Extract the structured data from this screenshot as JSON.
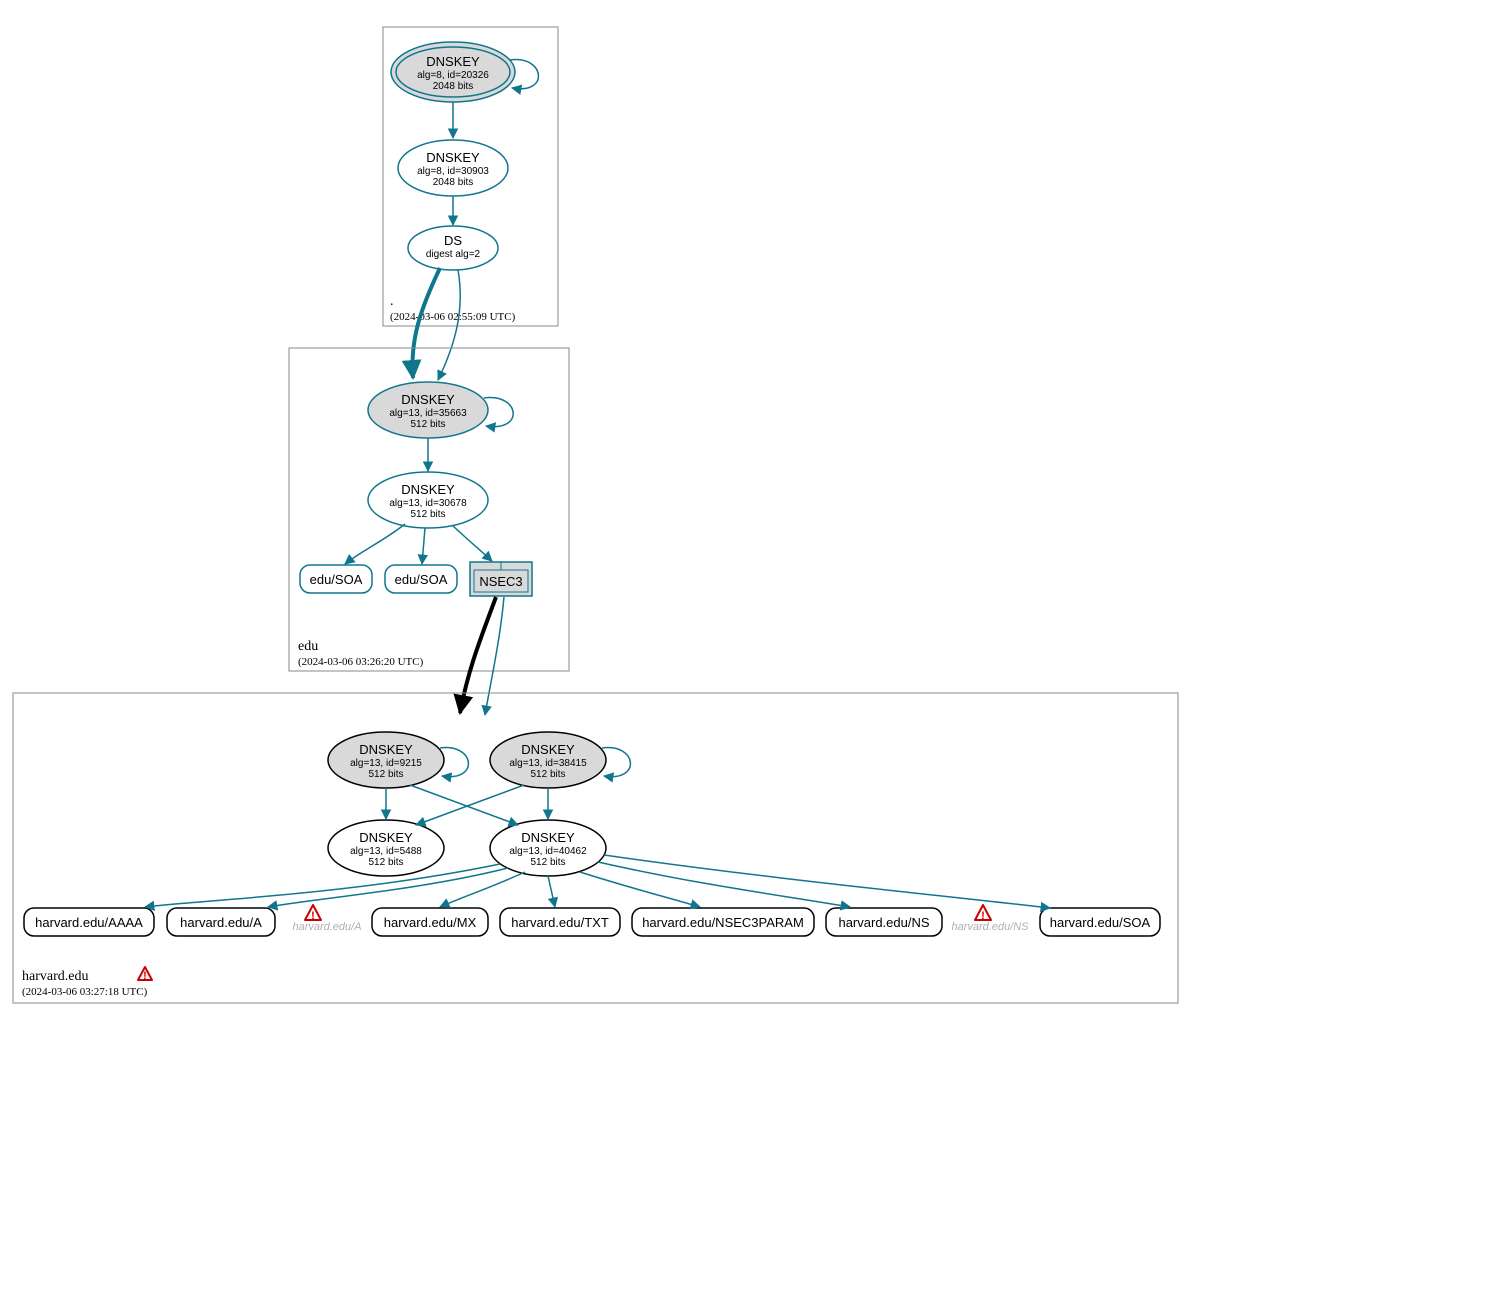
{
  "colors": {
    "teal": "#10768e",
    "gray_fill": "#d9d9d9",
    "warn": "#cc0000"
  },
  "zones": [
    {
      "id": "root",
      "label": ".",
      "timestamp": "(2024-03-06 02:55:09 UTC)",
      "nodes": [
        {
          "id": "root-ksk",
          "type": "ellipse-double",
          "fill": "gray",
          "title": "DNSKEY",
          "sub1": "alg=8, id=20326",
          "sub2": "2048 bits",
          "self_loop": true
        },
        {
          "id": "root-zsk",
          "type": "ellipse",
          "fill": "white",
          "title": "DNSKEY",
          "sub1": "alg=8, id=30903",
          "sub2": "2048 bits"
        },
        {
          "id": "root-ds",
          "type": "ellipse",
          "fill": "white",
          "title": "DS",
          "sub1": "digest alg=2"
        }
      ],
      "edges": [
        {
          "from": "root-ksk",
          "to": "root-zsk"
        },
        {
          "from": "root-zsk",
          "to": "root-ds"
        }
      ]
    },
    {
      "id": "edu",
      "label": "edu",
      "timestamp": "(2024-03-06 03:26:20 UTC)",
      "nodes": [
        {
          "id": "edu-ksk",
          "type": "ellipse",
          "fill": "gray",
          "title": "DNSKEY",
          "sub1": "alg=13, id=35663",
          "sub2": "512 bits",
          "self_loop": true
        },
        {
          "id": "edu-zsk",
          "type": "ellipse",
          "fill": "white",
          "title": "DNSKEY",
          "sub1": "alg=13, id=30678",
          "sub2": "512 bits"
        },
        {
          "id": "edu-soa1",
          "type": "rrect",
          "label": "edu/SOA"
        },
        {
          "id": "edu-soa2",
          "type": "rrect",
          "label": "edu/SOA"
        },
        {
          "id": "edu-nsec3",
          "type": "nsec3",
          "label": "NSEC3"
        }
      ],
      "edges": [
        {
          "from": "edu-ksk",
          "to": "edu-zsk"
        },
        {
          "from": "edu-zsk",
          "to": "edu-soa1"
        },
        {
          "from": "edu-zsk",
          "to": "edu-soa2"
        },
        {
          "from": "edu-zsk",
          "to": "edu-nsec3"
        }
      ]
    },
    {
      "id": "harvard",
      "label": "harvard.edu",
      "timestamp": "(2024-03-06 03:27:18 UTC)",
      "warning": true,
      "nodes": [
        {
          "id": "h-ksk1",
          "type": "ellipse",
          "fill": "gray",
          "stroke": "black",
          "title": "DNSKEY",
          "sub1": "alg=13, id=9215",
          "sub2": "512 bits",
          "self_loop": true
        },
        {
          "id": "h-ksk2",
          "type": "ellipse",
          "fill": "gray",
          "stroke": "black",
          "title": "DNSKEY",
          "sub1": "alg=13, id=38415",
          "sub2": "512 bits",
          "self_loop": true
        },
        {
          "id": "h-zsk1",
          "type": "ellipse",
          "fill": "whiteblack",
          "title": "DNSKEY",
          "sub1": "alg=13, id=5488",
          "sub2": "512 bits"
        },
        {
          "id": "h-zsk2",
          "type": "ellipse",
          "fill": "whiteblack",
          "title": "DNSKEY",
          "sub1": "alg=13, id=40462",
          "sub2": "512 bits"
        },
        {
          "id": "h-aaaa",
          "type": "rrect-black",
          "label": "harvard.edu/AAAA"
        },
        {
          "id": "h-a",
          "type": "rrect-black",
          "label": "harvard.edu/A"
        },
        {
          "id": "h-a-warn",
          "type": "warn",
          "label": "harvard.edu/A"
        },
        {
          "id": "h-mx",
          "type": "rrect-black",
          "label": "harvard.edu/MX"
        },
        {
          "id": "h-txt",
          "type": "rrect-black",
          "label": "harvard.edu/TXT"
        },
        {
          "id": "h-nsec3p",
          "type": "rrect-black",
          "label": "harvard.edu/NSEC3PARAM"
        },
        {
          "id": "h-ns",
          "type": "rrect-black",
          "label": "harvard.edu/NS"
        },
        {
          "id": "h-ns-warn",
          "type": "warn",
          "label": "harvard.edu/NS"
        },
        {
          "id": "h-soa",
          "type": "rrect-black",
          "label": "harvard.edu/SOA"
        }
      ],
      "edges": [
        {
          "from": "h-ksk1",
          "to": "h-zsk1"
        },
        {
          "from": "h-ksk1",
          "to": "h-zsk2"
        },
        {
          "from": "h-ksk2",
          "to": "h-zsk1"
        },
        {
          "from": "h-ksk2",
          "to": "h-zsk2"
        },
        {
          "from": "h-zsk2",
          "to": "h-aaaa"
        },
        {
          "from": "h-zsk2",
          "to": "h-a"
        },
        {
          "from": "h-zsk2",
          "to": "h-mx"
        },
        {
          "from": "h-zsk2",
          "to": "h-txt"
        },
        {
          "from": "h-zsk2",
          "to": "h-nsec3p"
        },
        {
          "from": "h-zsk2",
          "to": "h-ns"
        },
        {
          "from": "h-zsk2",
          "to": "h-soa"
        }
      ]
    }
  ],
  "interzone_edges": [
    {
      "from_zone": "root",
      "to_zone": "edu",
      "from": "root-ds",
      "to": "edu-ksk",
      "style": "bold-teal"
    },
    {
      "from_zone": "root",
      "to_zone": "edu",
      "from": "root-ds",
      "to": "edu-ksk",
      "style": "thin-teal"
    },
    {
      "from_zone": "edu",
      "to_zone": "harvard",
      "from": "edu-nsec3",
      "to": "h-ksk1",
      "style": "bold-black"
    },
    {
      "from_zone": "edu",
      "to_zone": "harvard",
      "from": "edu-nsec3",
      "to": "h-ksk2",
      "style": "thin-teal"
    }
  ]
}
